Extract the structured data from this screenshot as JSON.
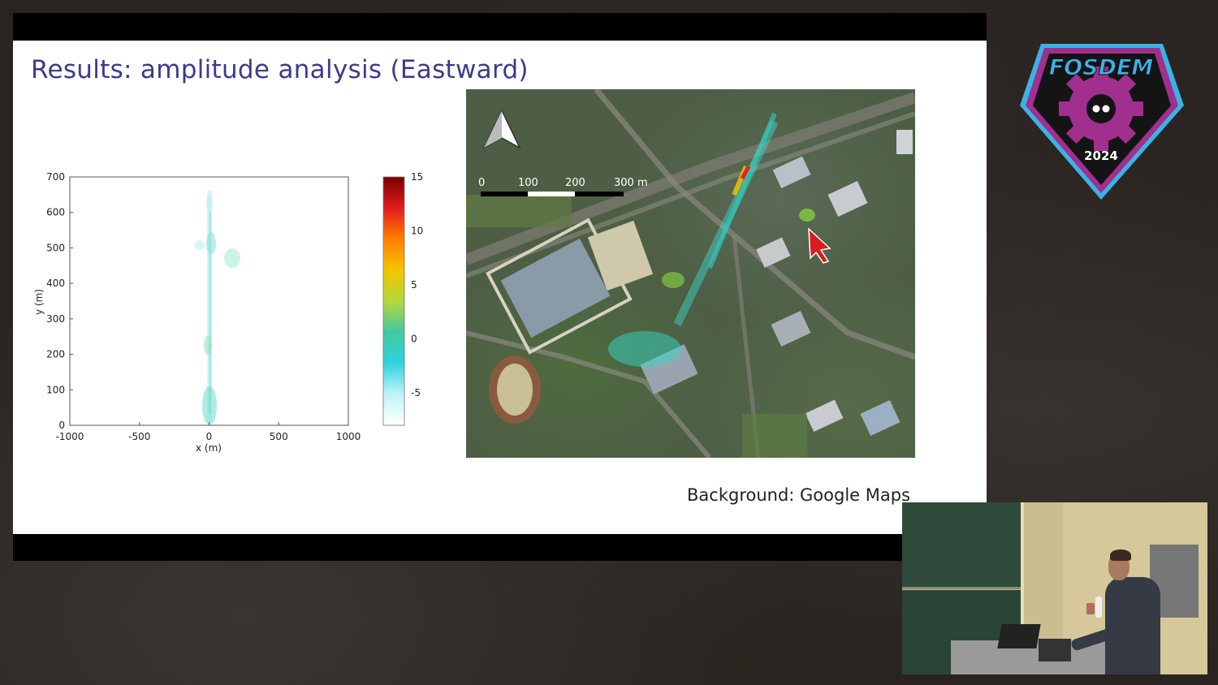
{
  "slide": {
    "title": "Results: amplitude analysis (Eastward)",
    "caption": "Background: Google Maps"
  },
  "plot": {
    "y_ticks": [
      "700",
      "600",
      "500",
      "400",
      "300",
      "200",
      "100",
      "0"
    ],
    "x_ticks": [
      "-1000",
      "-500",
      "0",
      "500",
      "1000"
    ],
    "xlabel": "x (m)",
    "ylabel": "y (m)",
    "colorbar_ticks": [
      "15",
      "10",
      "5",
      "0",
      "-5"
    ],
    "colorbar_colors": [
      "#7a0000",
      "#e41a1c",
      "#ff7f00",
      "#f5c400",
      "#b6d83a",
      "#42c9a0",
      "#2fd3e0",
      "#bff3f7",
      "#ffffff"
    ]
  },
  "map": {
    "scale_labels": [
      "0",
      "100",
      "200",
      "300 m"
    ],
    "north_arrow_icon": "north-arrow-icon",
    "pointer_icon": "red-arrow-pointer-icon"
  },
  "logo": {
    "name": "FOSDEM",
    "year": "2024",
    "colors": {
      "outline": "#3ab3e6",
      "fill": "#a12f8e",
      "bg": "#111111"
    }
  },
  "webcam": {
    "icon": "speaker-webcam-feed"
  }
}
